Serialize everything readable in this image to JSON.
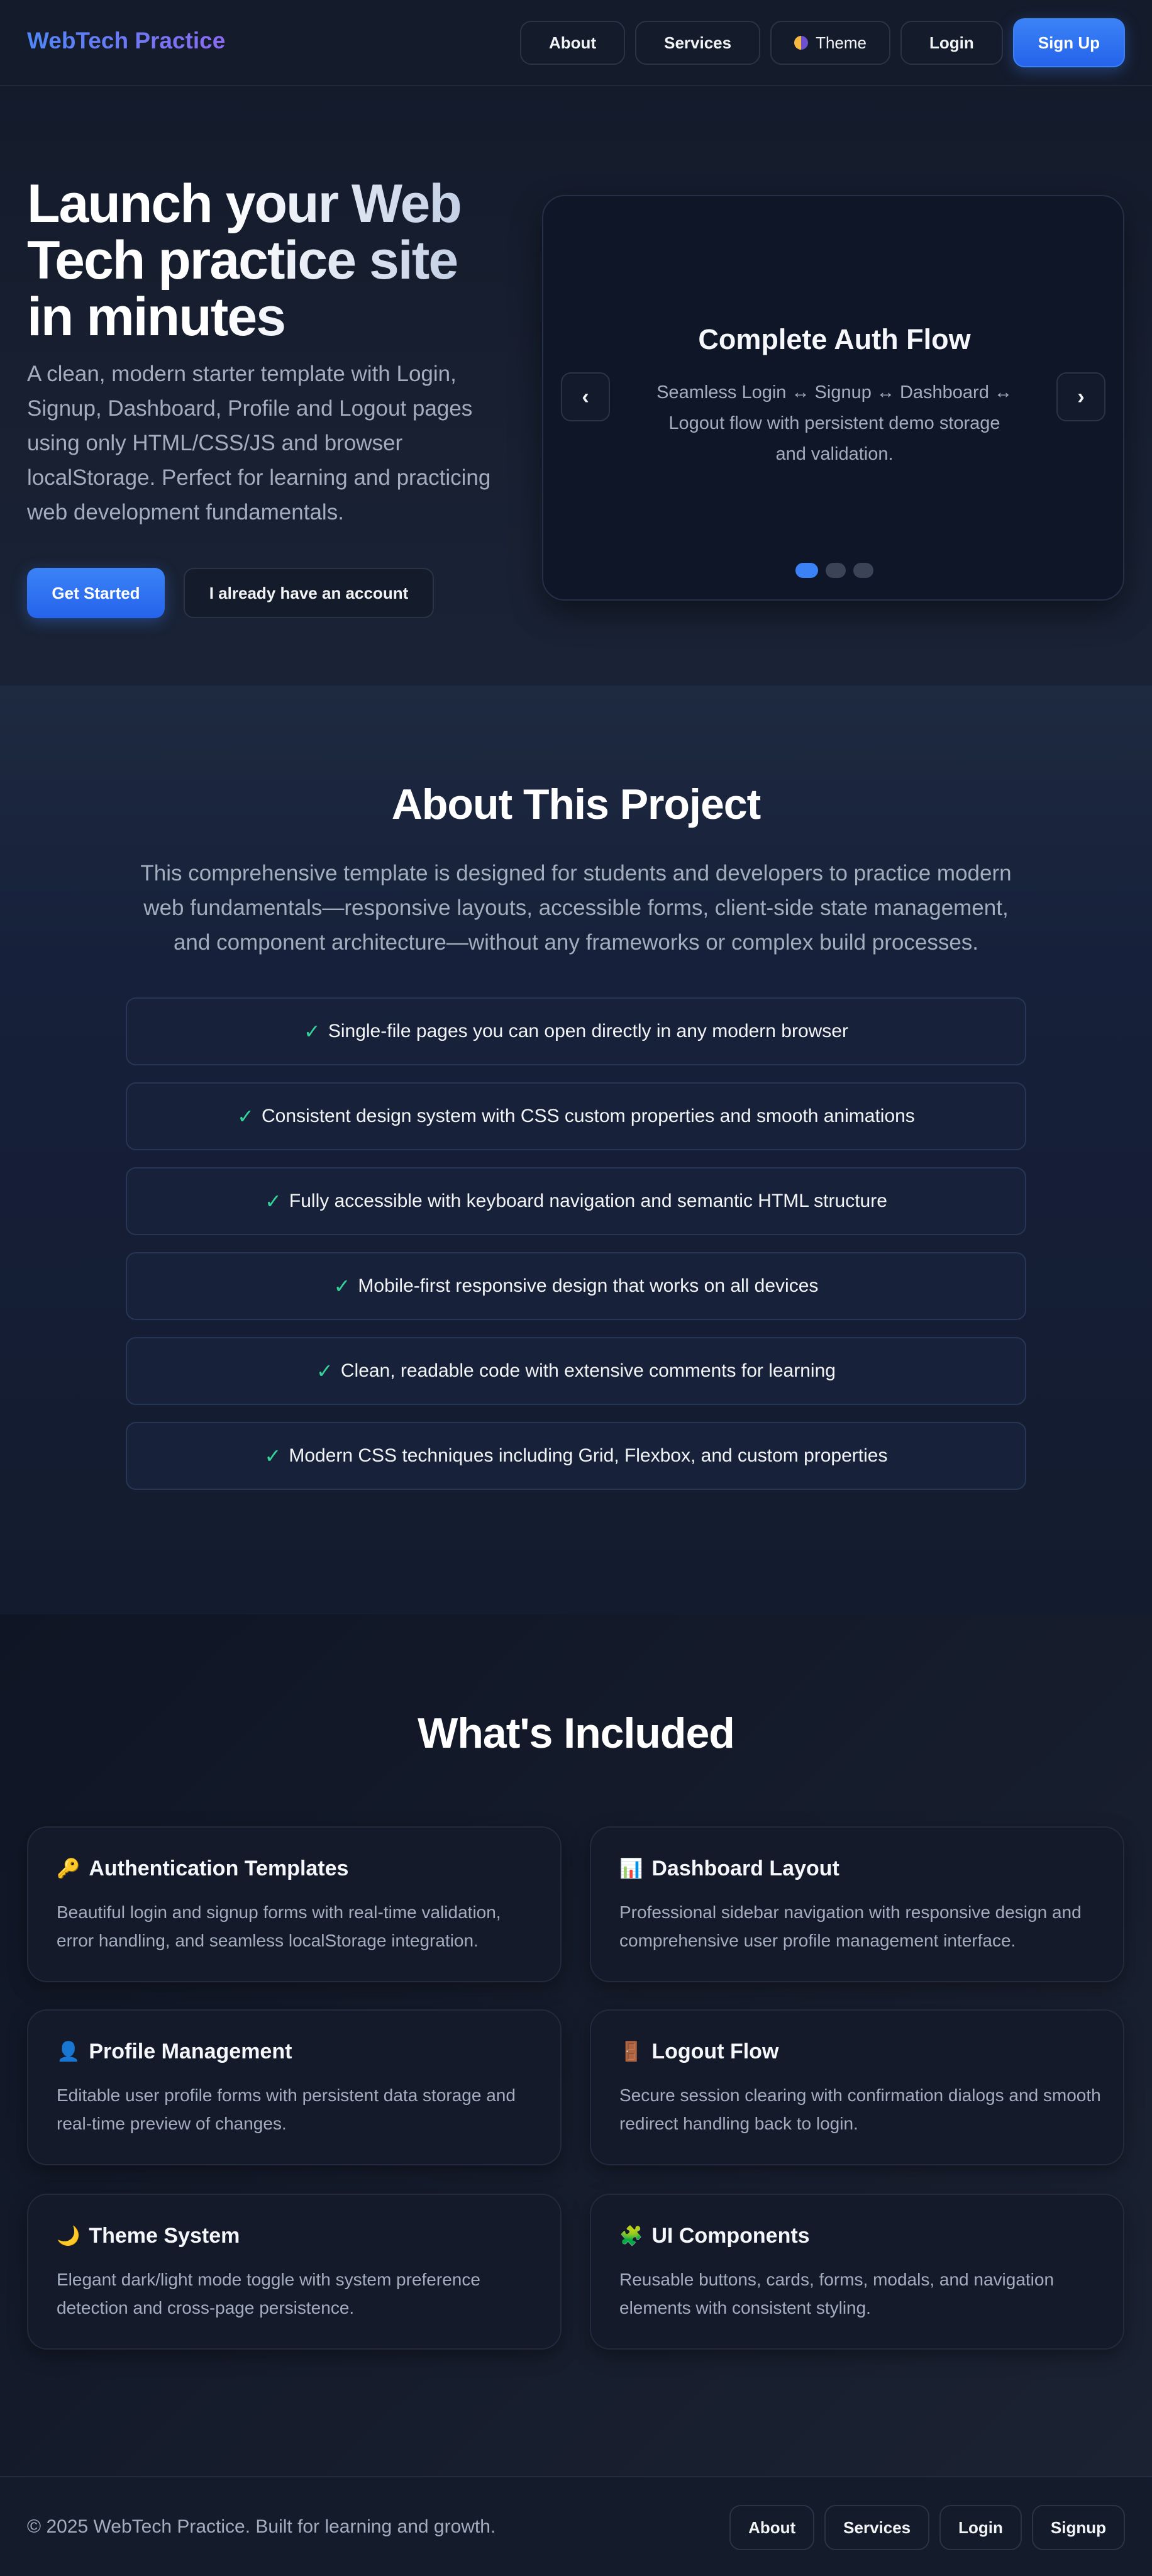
{
  "header": {
    "brand": "WebTech Practice",
    "nav": {
      "about": "About",
      "services": "Services",
      "theme": "Theme",
      "login": "Login",
      "signup": "Sign Up"
    }
  },
  "hero": {
    "title": "Launch your Web Tech practice site in minutes",
    "text": "A clean, modern starter template with Login, Signup, Dashboard, Profile and Logout pages using only HTML/CSS/JS and browser localStorage. Perfect for learning and practicing web development fundamentals.",
    "primary_button": "Get Started",
    "secondary_button": "I already have an account",
    "carousel": {
      "title": "Complete Auth Flow",
      "text": "Seamless Login ↔ Signup ↔ Dashboard ↔ Logout flow with persistent demo storage and validation.",
      "prev": "‹",
      "next": "›",
      "slide_count": 3,
      "active_slide": 1
    }
  },
  "about": {
    "title": "About This Project",
    "text": "This comprehensive template is designed for students and developers to practice modern web fundamentals—responsive layouts, accessible forms, client-side state management, and component architecture—without any frameworks or complex build processes.",
    "check": "✓",
    "features": [
      "Single-file pages you can open directly in any modern browser",
      "Consistent design system with CSS custom properties and smooth animations",
      "Fully accessible with keyboard navigation and semantic HTML structure",
      "Mobile-first responsive design that works on all devices",
      "Clean, readable code with extensive comments for learning",
      "Modern CSS techniques including Grid, Flexbox, and custom properties"
    ]
  },
  "included": {
    "title": "What's Included",
    "cards": [
      {
        "icon": "🔑",
        "title": "Authentication Templates",
        "text": "Beautiful login and signup forms with real-time validation, error handling, and seamless localStorage integration."
      },
      {
        "icon": "📊",
        "title": "Dashboard Layout",
        "text": "Professional sidebar navigation with responsive design and comprehensive user profile management interface."
      },
      {
        "icon": "👤",
        "title": "Profile Management",
        "text": "Editable user profile forms with persistent data storage and real-time preview of changes."
      },
      {
        "icon": "🚪",
        "title": "Logout Flow",
        "text": "Secure session clearing with confirmation dialogs and smooth redirect handling back to login."
      },
      {
        "icon": "🌙",
        "title": "Theme System",
        "text": "Elegant dark/light mode toggle with system preference detection and cross-page persistence."
      },
      {
        "icon": "🧩",
        "title": "UI Components",
        "text": "Reusable buttons, cards, forms, modals, and navigation elements with consistent styling."
      }
    ]
  },
  "footer": {
    "copyright": "© 2025 WebTech Practice. Built for learning and growth.",
    "links": {
      "about": "About",
      "services": "Services",
      "login": "Login",
      "signup": "Signup"
    }
  },
  "colors": {
    "accent": "#3b82f6",
    "check": "#34d399",
    "background": "#111827"
  }
}
